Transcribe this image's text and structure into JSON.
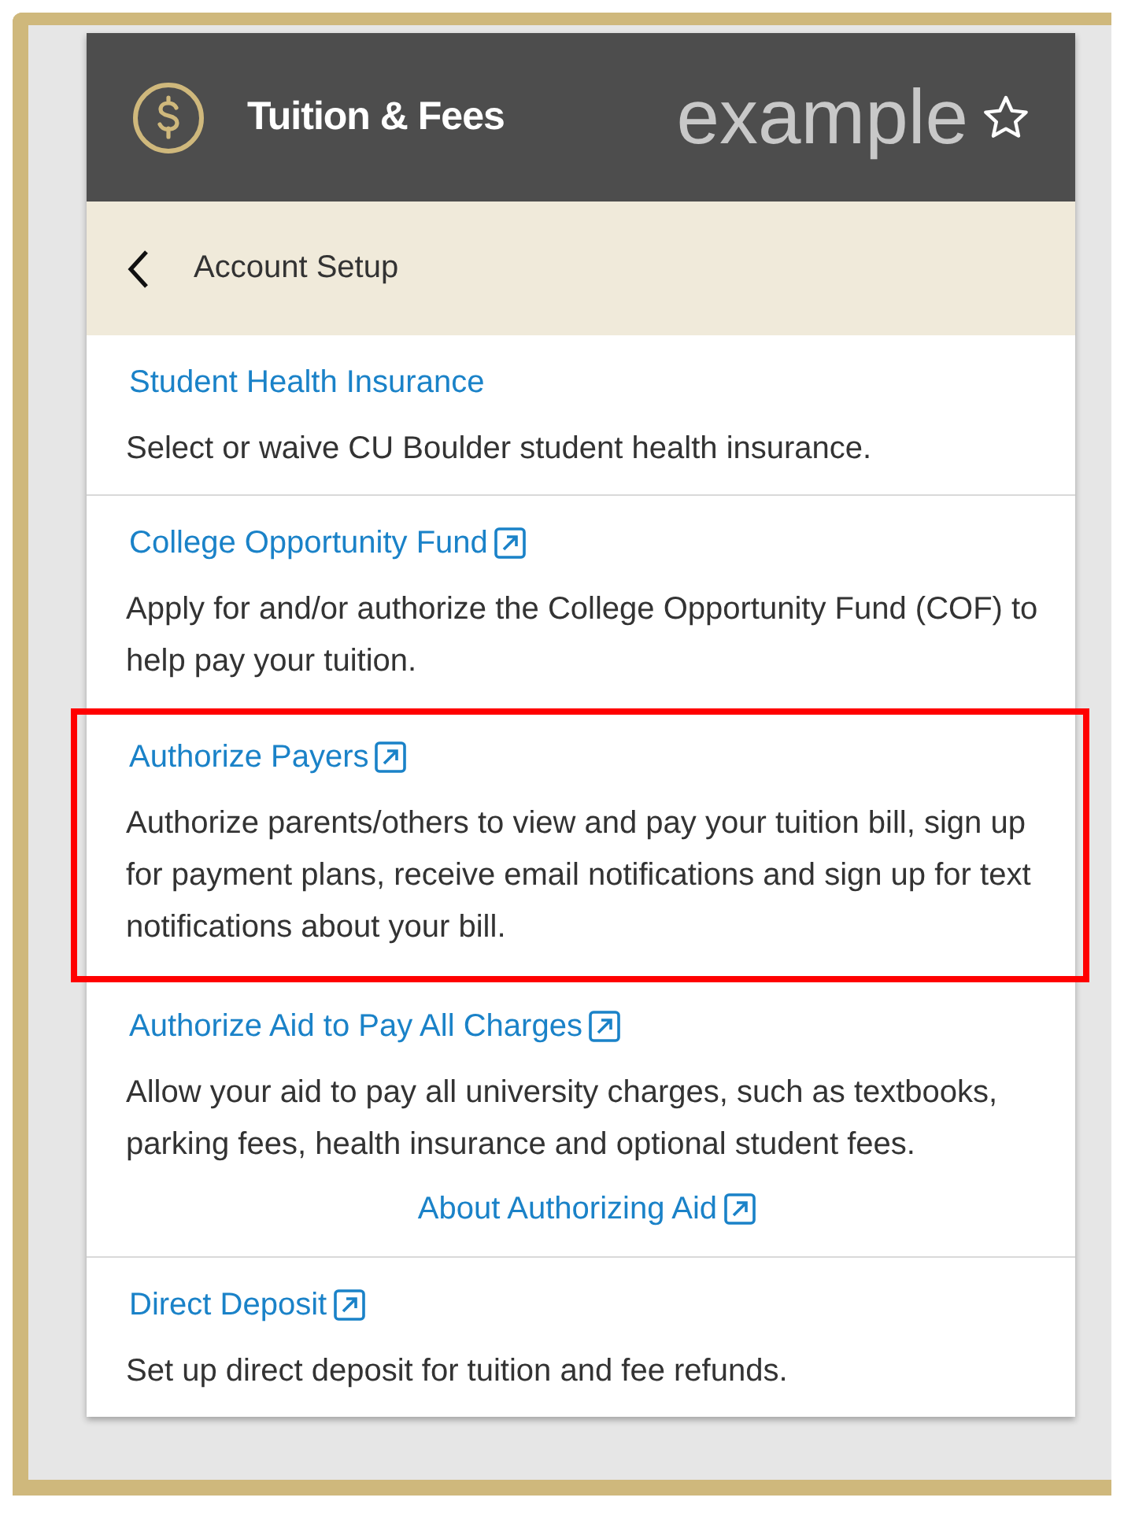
{
  "header": {
    "title": "Tuition & Fees",
    "tag": "example"
  },
  "subheader": {
    "title": "Account Setup"
  },
  "sections": [
    {
      "title": "Student Health Insurance",
      "external": false,
      "highlighted": false,
      "divider": false,
      "description": "Select or waive CU Boulder student health insurance."
    },
    {
      "title": "College Opportunity Fund",
      "external": true,
      "highlighted": false,
      "divider": true,
      "description": "Apply for and/or authorize the College Opportunity Fund (COF) to help pay your tuition."
    },
    {
      "title": "Authorize Payers",
      "external": true,
      "highlighted": true,
      "divider": false,
      "description": "Authorize parents/others to view and pay your tuition bill, sign up for payment plans, receive email notifications and sign up for text notifications about your bill."
    },
    {
      "title": "Authorize Aid to Pay All Charges",
      "external": true,
      "highlighted": false,
      "divider": false,
      "description": "Allow your aid to pay all university charges, such as textbooks, parking fees, health insurance and optional student fees.",
      "extra_link": {
        "title": "About Authorizing Aid",
        "external": true
      }
    },
    {
      "title": "Direct Deposit",
      "external": true,
      "highlighted": false,
      "divider": true,
      "description": "Set up direct deposit for tuition and fee refunds."
    }
  ]
}
